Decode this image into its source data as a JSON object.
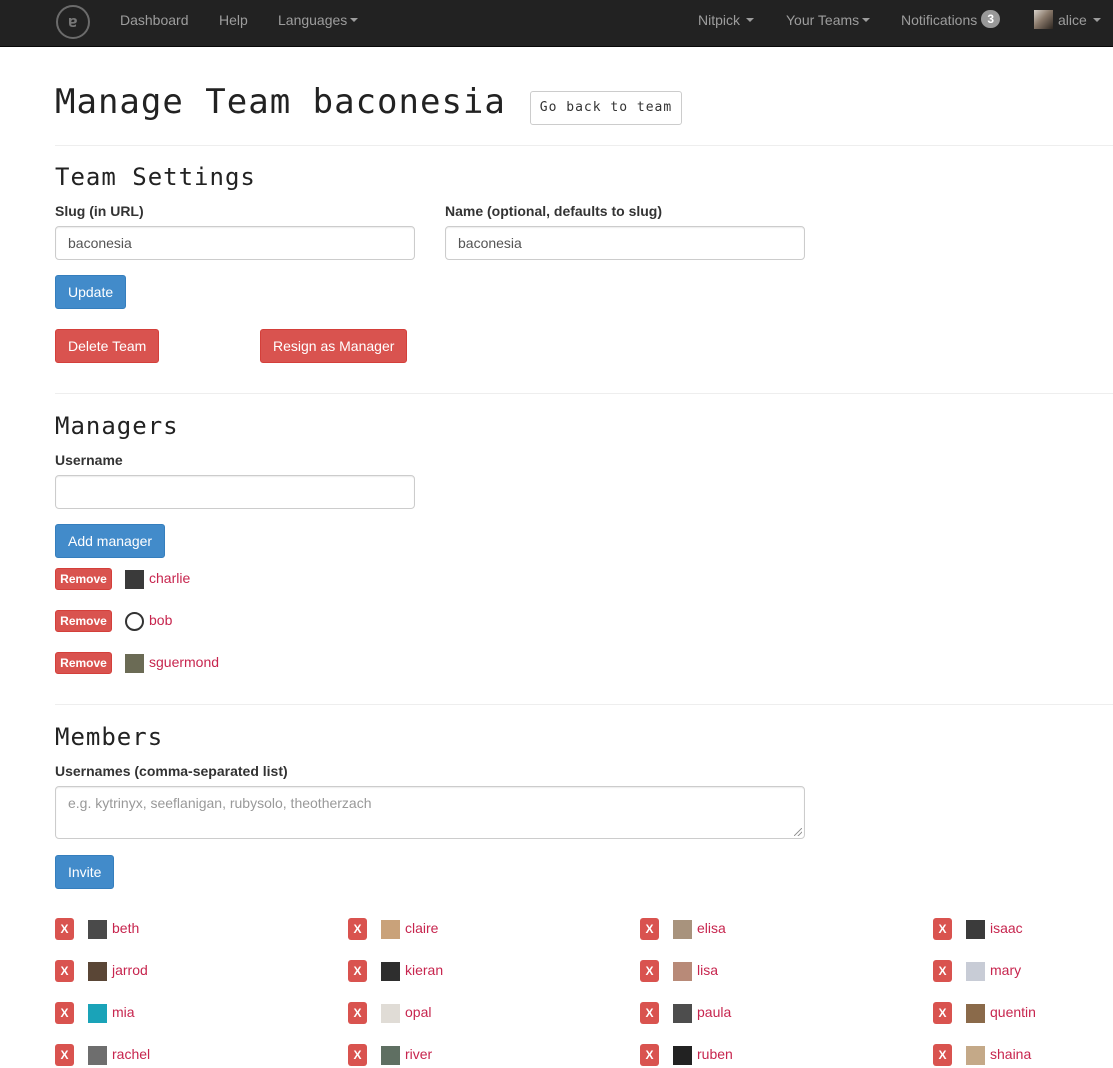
{
  "nav": {
    "logo_glyph": "ɐ",
    "dashboard": "Dashboard",
    "help": "Help",
    "languages": "Languages",
    "nitpick": "Nitpick",
    "your_teams": "Your Teams",
    "notifications": "Notifications",
    "notifications_count": "3",
    "user": "alice"
  },
  "page": {
    "title": "Manage Team baconesia",
    "back_button": "Go back to team"
  },
  "settings": {
    "heading": "Team Settings",
    "slug_label": "Slug (in URL)",
    "slug_value": "baconesia",
    "name_label": "Name (optional, defaults to slug)",
    "name_value": "baconesia",
    "update_button": "Update",
    "delete_button": "Delete Team",
    "resign_button": "Resign as Manager"
  },
  "managers": {
    "heading": "Managers",
    "username_label": "Username",
    "username_value": "",
    "add_button": "Add manager",
    "remove_label": "Remove",
    "list": [
      {
        "name": "charlie",
        "avatar_color": "#3a3a3a"
      },
      {
        "name": "bob",
        "avatar_color": "#ffffff"
      },
      {
        "name": "sguermond",
        "avatar_color": "#6b6b55"
      }
    ]
  },
  "members": {
    "heading": "Members",
    "usernames_label": "Usernames (comma-separated list)",
    "usernames_placeholder": "e.g. kytrinyx, seeflanigan, rubysolo, theotherzach",
    "invite_button": "Invite",
    "remove_glyph": "X",
    "list": [
      {
        "name": "beth",
        "avatar_color": "#4a4a4a"
      },
      {
        "name": "claire",
        "avatar_color": "#c9a27a"
      },
      {
        "name": "elisa",
        "avatar_color": "#a8937d"
      },
      {
        "name": "isaac",
        "avatar_color": "#3b3b3b"
      },
      {
        "name": "jarrod",
        "avatar_color": "#5a4636"
      },
      {
        "name": "kieran",
        "avatar_color": "#2e2e2e"
      },
      {
        "name": "lisa",
        "avatar_color": "#b88a78"
      },
      {
        "name": "mary",
        "avatar_color": "#c8ccd6"
      },
      {
        "name": "mia",
        "avatar_color": "#1aa3b8"
      },
      {
        "name": "opal",
        "avatar_color": "#e0dcd6"
      },
      {
        "name": "paula",
        "avatar_color": "#4d4d4d"
      },
      {
        "name": "quentin",
        "avatar_color": "#8a6a4a"
      },
      {
        "name": "rachel",
        "avatar_color": "#6e6e6e"
      },
      {
        "name": "river",
        "avatar_color": "#5f6f62"
      },
      {
        "name": "ruben",
        "avatar_color": "#222222"
      },
      {
        "name": "shaina",
        "avatar_color": "#c4a988"
      }
    ]
  },
  "colors": {
    "navbar": "#222222",
    "primary": "#428bca",
    "danger": "#d9534f",
    "link": "#c7254e"
  }
}
